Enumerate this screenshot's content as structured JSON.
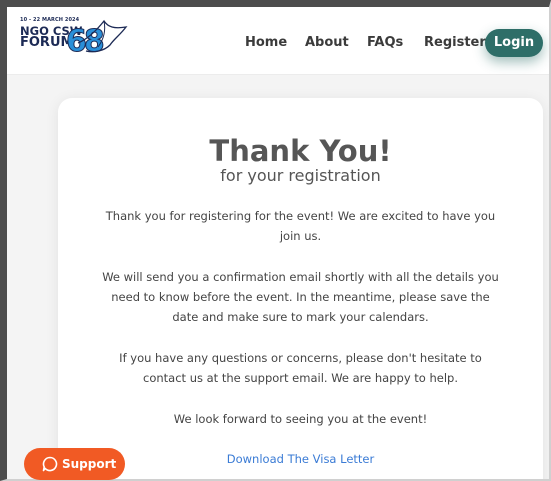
{
  "logo": {
    "date": "10 - 22 MARCH 2024",
    "line1": "NGO CSW",
    "line2": "FORUM",
    "number": "68"
  },
  "nav": {
    "items": [
      {
        "label": "Home"
      },
      {
        "label": "About"
      },
      {
        "label": "FAQs"
      },
      {
        "label": "Register"
      }
    ],
    "login_label": "Login"
  },
  "card": {
    "title": "Thank You!",
    "subtitle": "for your registration",
    "paragraphs": [
      "Thank you for registering for the event! We are excited to have you join us.",
      "We will send you a confirmation email shortly with all the details you need to know before the event. In the meantime, please save the date and make sure to mark your calendars.",
      "If you have any questions or concerns, please don't hesitate to contact us at the support email. We are happy to help.",
      "We look forward to seeing you at the event!"
    ],
    "visa_link": "Download The Visa Letter"
  },
  "support": {
    "label": "Support",
    "icon": "chat-bubble-icon"
  },
  "colors": {
    "login_bg": "#2e6e68",
    "support_bg": "#f15a24",
    "link": "#3a7bd5",
    "logo_navy": "#1c2a55",
    "logo_blue": "#2a8fd8"
  }
}
